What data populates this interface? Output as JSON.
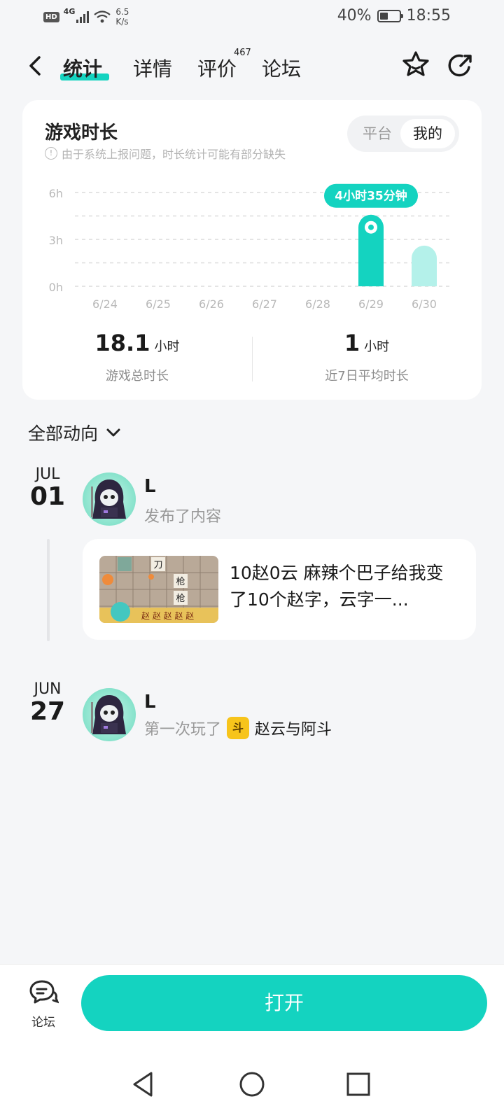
{
  "status_bar": {
    "network": "4G",
    "speed_value": "6.5",
    "speed_unit": "K/s",
    "battery": "40%",
    "time": "18:55"
  },
  "header": {
    "tabs": [
      {
        "label": "统计",
        "active": true
      },
      {
        "label": "详情",
        "active": false
      },
      {
        "label": "评价",
        "active": false,
        "badge": "467"
      },
      {
        "label": "论坛",
        "active": false
      }
    ],
    "icons": [
      "back-icon",
      "star-icon",
      "share-icon"
    ]
  },
  "play_time": {
    "title": "游戏时长",
    "note": "由于系统上报问题，时长统计可能有部分缺失",
    "toggle": {
      "left": "平台",
      "right": "我的",
      "selected": "我的"
    },
    "total": {
      "value": "18.1",
      "unit": "小时",
      "label": "游戏总时长"
    },
    "average": {
      "value": "1",
      "unit": "小时",
      "label": "近7日平均时长"
    }
  },
  "chart_data": {
    "type": "bar",
    "categories": [
      "6/24",
      "6/25",
      "6/26",
      "6/27",
      "6/28",
      "6/29",
      "6/30"
    ],
    "values": [
      0,
      0,
      0,
      0,
      0,
      4.58,
      2.6
    ],
    "y_ticks": [
      "0h",
      "3h",
      "6h"
    ],
    "ylim": [
      0,
      6
    ],
    "highlight_index": 5,
    "highlight_label": "4小时35分钟",
    "grid": true,
    "colors": {
      "active": "#14d3c0",
      "inactive": "#b4f1ea"
    }
  },
  "activity": {
    "section_title": "全部动向",
    "entries": [
      {
        "month": "JUL",
        "day": "01",
        "user": "L",
        "action": "发布了内容",
        "post_text": "10赵0云 麻辣个巴子给我变了10个赵字，云字一..."
      },
      {
        "month": "JUN",
        "day": "27",
        "user": "L",
        "action": "第一次玩了",
        "game_icon_text": "斗",
        "game_name": "赵云与阿斗"
      }
    ]
  },
  "bottom_bar": {
    "forum_label": "论坛",
    "open_label": "打开"
  },
  "colors": {
    "accent": "#14d3c0",
    "background": "#f5f6f8",
    "card": "#ffffff"
  }
}
